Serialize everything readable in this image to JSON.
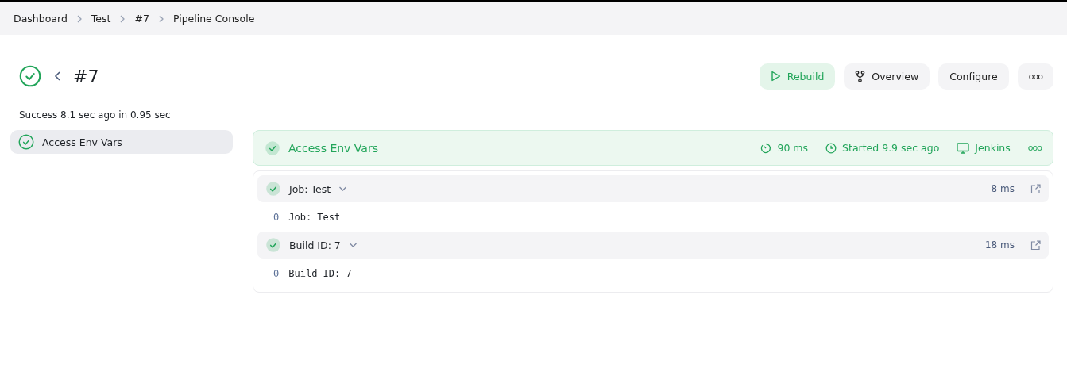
{
  "breadcrumbs": [
    "Dashboard",
    "Test",
    "#7",
    "Pipeline Console"
  ],
  "header": {
    "passed": true,
    "title": "#7",
    "summary": "Success 8.1 sec ago in 0.95 sec"
  },
  "actions": [
    {
      "kind": "rebuild",
      "label": "Rebuild"
    },
    {
      "kind": "overview",
      "label": "Overview"
    },
    {
      "kind": "plain",
      "label": "Configure"
    },
    {
      "kind": "more",
      "label": "ooo"
    }
  ],
  "sidebar": {
    "items": [
      {
        "label": "Access Env Vars",
        "passed": true,
        "selected": true
      }
    ]
  },
  "stage": {
    "name": "Access Env Vars",
    "passed": true,
    "duration": "90 ms",
    "started": "Started 9.9 sec ago",
    "agent": "Jenkins",
    "more": "ooo"
  },
  "steps": [
    {
      "title": "Job: Test",
      "passed": true,
      "expanded": true,
      "duration": "8 ms",
      "lines": [
        {
          "number": "0",
          "text": "Job: Test"
        }
      ]
    },
    {
      "title": "Build ID: 7",
      "passed": true,
      "expanded": true,
      "duration": "18 ms",
      "lines": [
        {
          "number": "0",
          "text": "Build ID: 7"
        }
      ]
    }
  ]
}
